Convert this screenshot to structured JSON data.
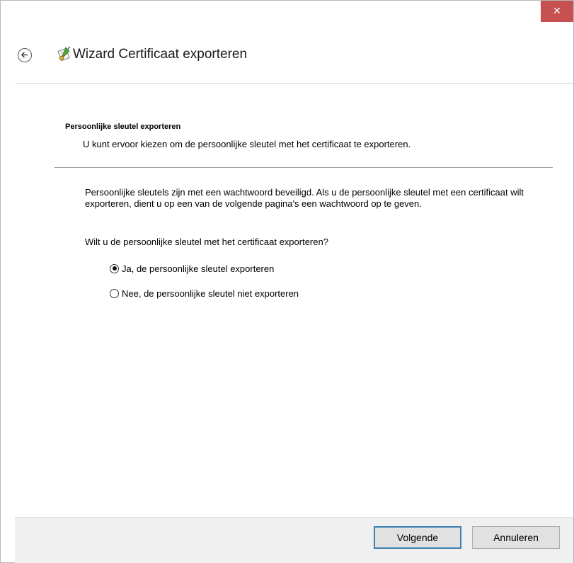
{
  "window": {
    "title": "Wizard Certificaat exporteren",
    "close_glyph": "✕"
  },
  "section": {
    "title": "Persoonlijke sleutel exporteren",
    "description": "U kunt ervoor kiezen om de persoonlijke sleutel met het certificaat te exporteren."
  },
  "body": {
    "info": "Persoonlijke sleutels zijn met een wachtwoord beveiligd. Als u de persoonlijke sleutel met een certificaat wilt exporteren, dient u op een van de volgende pagina's een wachtwoord op te geven.",
    "question": "Wilt u de persoonlijke sleutel met het certificaat exporteren?"
  },
  "options": [
    {
      "label": "Ja, de persoonlijke sleutel exporteren",
      "checked": true
    },
    {
      "label": "Nee, de persoonlijke sleutel niet exporteren",
      "checked": false
    }
  ],
  "buttons": {
    "next": "Volgende",
    "cancel": "Annuleren"
  },
  "colors": {
    "close_button": "#c75050",
    "footer_bg": "#f0f0f0",
    "primary_border": "#3c7fb1"
  },
  "icons": {
    "back": "back-arrow-circle-icon",
    "wizard": "certificate-wizard-icon",
    "close": "close-icon"
  }
}
